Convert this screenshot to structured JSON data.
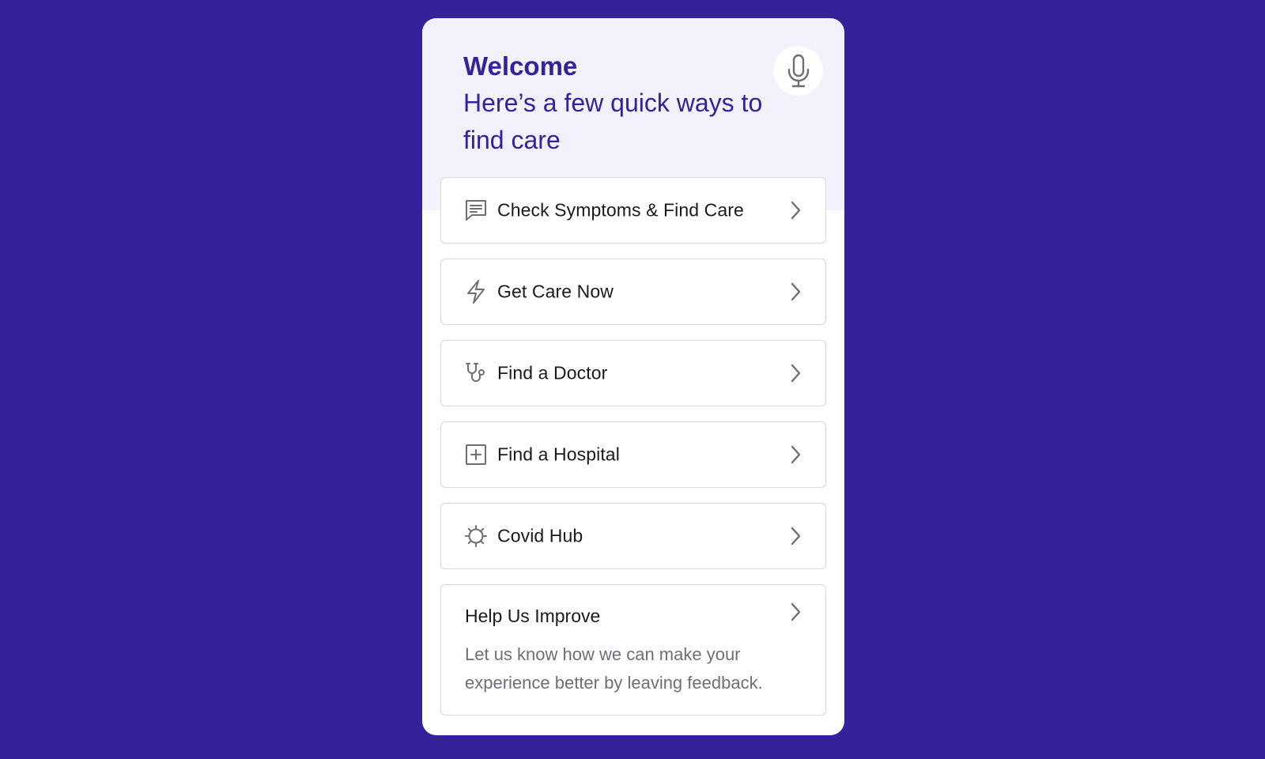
{
  "header": {
    "title": "Welcome",
    "subtitle": "Here’s a few quick ways to find care",
    "mic_icon": "microphone-icon"
  },
  "menu": {
    "items": [
      {
        "label": "Check Symptoms & Find Care",
        "icon": "chat-message-icon"
      },
      {
        "label": "Get Care Now",
        "icon": "lightning-bolt-icon"
      },
      {
        "label": "Find a Doctor",
        "icon": "stethoscope-icon"
      },
      {
        "label": "Find a Hospital",
        "icon": "plus-square-icon"
      },
      {
        "label": "Covid Hub",
        "icon": "virus-icon"
      }
    ],
    "chevron_icon": "chevron-right-icon"
  },
  "feedback": {
    "title": "Help Us Improve",
    "description": "Let us know how we can make your experience better by leaving feedback."
  },
  "colors": {
    "background": "#35229a",
    "header_bg": "#f3f1fc",
    "accent": "#35229a",
    "icon_gray": "#6e6e78",
    "border": "#d6d6dc"
  }
}
